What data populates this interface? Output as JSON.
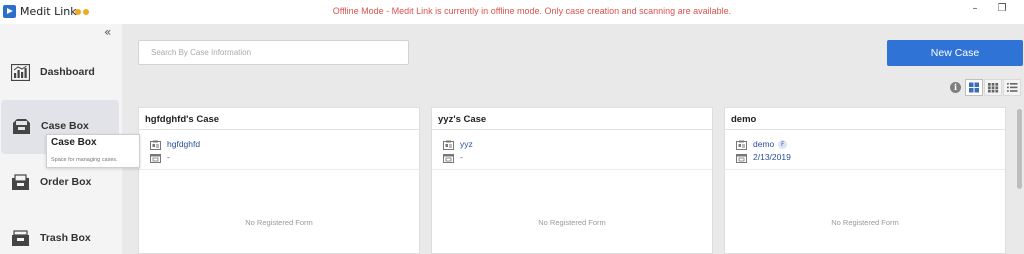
{
  "app": {
    "title": "Medit Link"
  },
  "banner": {
    "offline_message": "Offline Mode - Medit Link is currently in offline mode. Only case creation and scanning are available."
  },
  "window_controls": {
    "minimize": "–",
    "restore": "❐"
  },
  "sidebar": {
    "collapse_label": "«",
    "items": [
      {
        "label": "Dashboard",
        "icon": "dashboard-icon"
      },
      {
        "label": "Case Box",
        "icon": "case-box-icon",
        "active": true
      },
      {
        "label": "Order Box",
        "icon": "order-box-icon"
      },
      {
        "label": "Trash Box",
        "icon": "trash-box-icon"
      }
    ]
  },
  "tooltip": {
    "title": "Case Box",
    "description": "Space for managing cases."
  },
  "search": {
    "placeholder": "Search By Case Information"
  },
  "actions": {
    "new_case_label": "New Case"
  },
  "info_icon": "i",
  "cards": [
    {
      "title": "hgfdghfd's Case",
      "patient": "hgfdghfd",
      "badge": "",
      "date": "-",
      "form_status": "No Registered Form"
    },
    {
      "title": "yyz's Case",
      "patient": "yyz",
      "badge": "",
      "date": "-",
      "form_status": "No Registered Form"
    },
    {
      "title": "demo",
      "patient": "demo",
      "badge": "F",
      "date": "2/13/2019",
      "form_status": "No Registered Form"
    }
  ],
  "colors": {
    "accent": "#2f73d6",
    "offline_text": "#d9534f",
    "status_dot": "#f2a81f",
    "link": "#2b4f9e"
  }
}
